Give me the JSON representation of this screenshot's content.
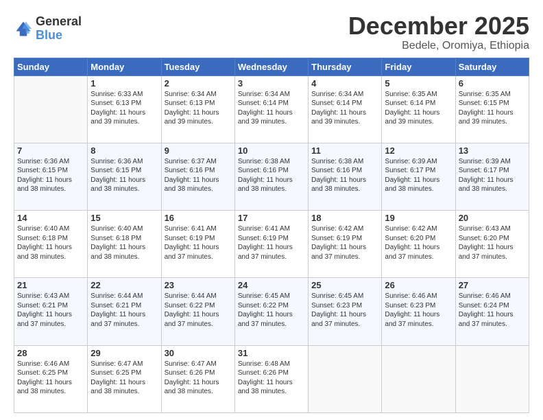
{
  "logo": {
    "general": "General",
    "blue": "Blue"
  },
  "header": {
    "title": "December 2025",
    "subtitle": "Bedele, Oromiya, Ethiopia"
  },
  "weekdays": [
    "Sunday",
    "Monday",
    "Tuesday",
    "Wednesday",
    "Thursday",
    "Friday",
    "Saturday"
  ],
  "weeks": [
    [
      {
        "day": "",
        "info": ""
      },
      {
        "day": "1",
        "info": "Sunrise: 6:33 AM\nSunset: 6:13 PM\nDaylight: 11 hours\nand 39 minutes."
      },
      {
        "day": "2",
        "info": "Sunrise: 6:34 AM\nSunset: 6:13 PM\nDaylight: 11 hours\nand 39 minutes."
      },
      {
        "day": "3",
        "info": "Sunrise: 6:34 AM\nSunset: 6:14 PM\nDaylight: 11 hours\nand 39 minutes."
      },
      {
        "day": "4",
        "info": "Sunrise: 6:34 AM\nSunset: 6:14 PM\nDaylight: 11 hours\nand 39 minutes."
      },
      {
        "day": "5",
        "info": "Sunrise: 6:35 AM\nSunset: 6:14 PM\nDaylight: 11 hours\nand 39 minutes."
      },
      {
        "day": "6",
        "info": "Sunrise: 6:35 AM\nSunset: 6:15 PM\nDaylight: 11 hours\nand 39 minutes."
      }
    ],
    [
      {
        "day": "7",
        "info": "Sunrise: 6:36 AM\nSunset: 6:15 PM\nDaylight: 11 hours\nand 38 minutes."
      },
      {
        "day": "8",
        "info": "Sunrise: 6:36 AM\nSunset: 6:15 PM\nDaylight: 11 hours\nand 38 minutes."
      },
      {
        "day": "9",
        "info": "Sunrise: 6:37 AM\nSunset: 6:16 PM\nDaylight: 11 hours\nand 38 minutes."
      },
      {
        "day": "10",
        "info": "Sunrise: 6:38 AM\nSunset: 6:16 PM\nDaylight: 11 hours\nand 38 minutes."
      },
      {
        "day": "11",
        "info": "Sunrise: 6:38 AM\nSunset: 6:16 PM\nDaylight: 11 hours\nand 38 minutes."
      },
      {
        "day": "12",
        "info": "Sunrise: 6:39 AM\nSunset: 6:17 PM\nDaylight: 11 hours\nand 38 minutes."
      },
      {
        "day": "13",
        "info": "Sunrise: 6:39 AM\nSunset: 6:17 PM\nDaylight: 11 hours\nand 38 minutes."
      }
    ],
    [
      {
        "day": "14",
        "info": "Sunrise: 6:40 AM\nSunset: 6:18 PM\nDaylight: 11 hours\nand 38 minutes."
      },
      {
        "day": "15",
        "info": "Sunrise: 6:40 AM\nSunset: 6:18 PM\nDaylight: 11 hours\nand 38 minutes."
      },
      {
        "day": "16",
        "info": "Sunrise: 6:41 AM\nSunset: 6:19 PM\nDaylight: 11 hours\nand 37 minutes."
      },
      {
        "day": "17",
        "info": "Sunrise: 6:41 AM\nSunset: 6:19 PM\nDaylight: 11 hours\nand 37 minutes."
      },
      {
        "day": "18",
        "info": "Sunrise: 6:42 AM\nSunset: 6:19 PM\nDaylight: 11 hours\nand 37 minutes."
      },
      {
        "day": "19",
        "info": "Sunrise: 6:42 AM\nSunset: 6:20 PM\nDaylight: 11 hours\nand 37 minutes."
      },
      {
        "day": "20",
        "info": "Sunrise: 6:43 AM\nSunset: 6:20 PM\nDaylight: 11 hours\nand 37 minutes."
      }
    ],
    [
      {
        "day": "21",
        "info": "Sunrise: 6:43 AM\nSunset: 6:21 PM\nDaylight: 11 hours\nand 37 minutes."
      },
      {
        "day": "22",
        "info": "Sunrise: 6:44 AM\nSunset: 6:21 PM\nDaylight: 11 hours\nand 37 minutes."
      },
      {
        "day": "23",
        "info": "Sunrise: 6:44 AM\nSunset: 6:22 PM\nDaylight: 11 hours\nand 37 minutes."
      },
      {
        "day": "24",
        "info": "Sunrise: 6:45 AM\nSunset: 6:22 PM\nDaylight: 11 hours\nand 37 minutes."
      },
      {
        "day": "25",
        "info": "Sunrise: 6:45 AM\nSunset: 6:23 PM\nDaylight: 11 hours\nand 37 minutes."
      },
      {
        "day": "26",
        "info": "Sunrise: 6:46 AM\nSunset: 6:23 PM\nDaylight: 11 hours\nand 37 minutes."
      },
      {
        "day": "27",
        "info": "Sunrise: 6:46 AM\nSunset: 6:24 PM\nDaylight: 11 hours\nand 37 minutes."
      }
    ],
    [
      {
        "day": "28",
        "info": "Sunrise: 6:46 AM\nSunset: 6:25 PM\nDaylight: 11 hours\nand 38 minutes."
      },
      {
        "day": "29",
        "info": "Sunrise: 6:47 AM\nSunset: 6:25 PM\nDaylight: 11 hours\nand 38 minutes."
      },
      {
        "day": "30",
        "info": "Sunrise: 6:47 AM\nSunset: 6:26 PM\nDaylight: 11 hours\nand 38 minutes."
      },
      {
        "day": "31",
        "info": "Sunrise: 6:48 AM\nSunset: 6:26 PM\nDaylight: 11 hours\nand 38 minutes."
      },
      {
        "day": "",
        "info": ""
      },
      {
        "day": "",
        "info": ""
      },
      {
        "day": "",
        "info": ""
      }
    ]
  ]
}
